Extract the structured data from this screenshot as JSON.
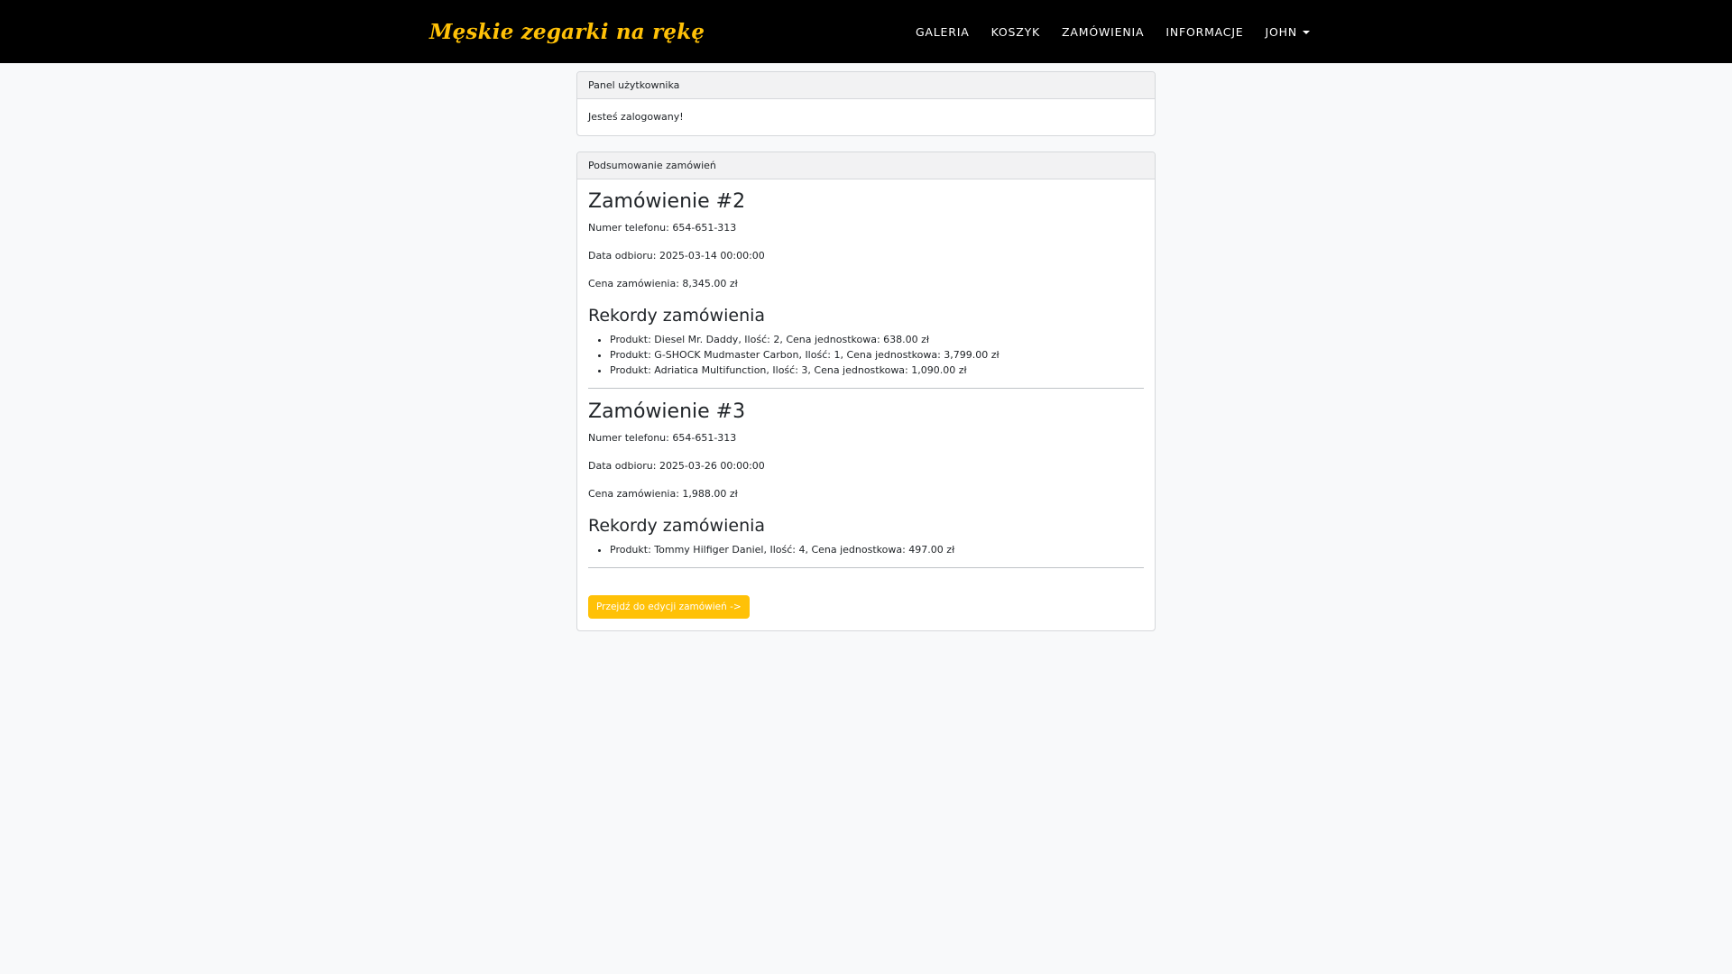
{
  "navbar": {
    "brand": "Męskie zegarki na rękę",
    "links": [
      "GALERIA",
      "KOSZYK",
      "ZAMÓWIENIA",
      "INFORMACJE"
    ],
    "user_menu": "JOHN"
  },
  "user_panel": {
    "header": "Panel użytkownika",
    "message": "Jesteś zalogowany!"
  },
  "orders_summary": {
    "header": "Podsumowanie zamówień",
    "orders": [
      {
        "title": "Zamówienie #2",
        "phone": "Numer telefonu: 654-651-313",
        "pickup_date": "Data odbioru: 2025-03-14 00:00:00",
        "price": "Cena zamówienia: 8,345.00 zł",
        "records_title": "Rekordy zamówienia",
        "records": [
          "Produkt: Diesel Mr. Daddy, Ilość: 2, Cena jednostkowa: 638.00 zł",
          "Produkt: G-SHOCK Mudmaster Carbon, Ilość: 1, Cena jednostkowa: 3,799.00 zł",
          "Produkt: Adriatica Multifunction, Ilość: 3, Cena jednostkowa: 1,090.00 zł"
        ]
      },
      {
        "title": "Zamówienie #3",
        "phone": "Numer telefonu: 654-651-313",
        "pickup_date": "Data odbioru: 2025-03-26 00:00:00",
        "price": "Cena zamówienia: 1,988.00 zł",
        "records_title": "Rekordy zamówienia",
        "records": [
          "Produkt: Tommy Hilfiger Daniel, Ilość: 4, Cena jednostkowa: 497.00 zł"
        ]
      }
    ],
    "edit_button": "Przejdź do edycji zamówień ->"
  },
  "colors": {
    "navbar_bg": "#000000",
    "brand": "#ffc107",
    "button": "#ffc107",
    "page_bg": "#f8f9fa"
  }
}
